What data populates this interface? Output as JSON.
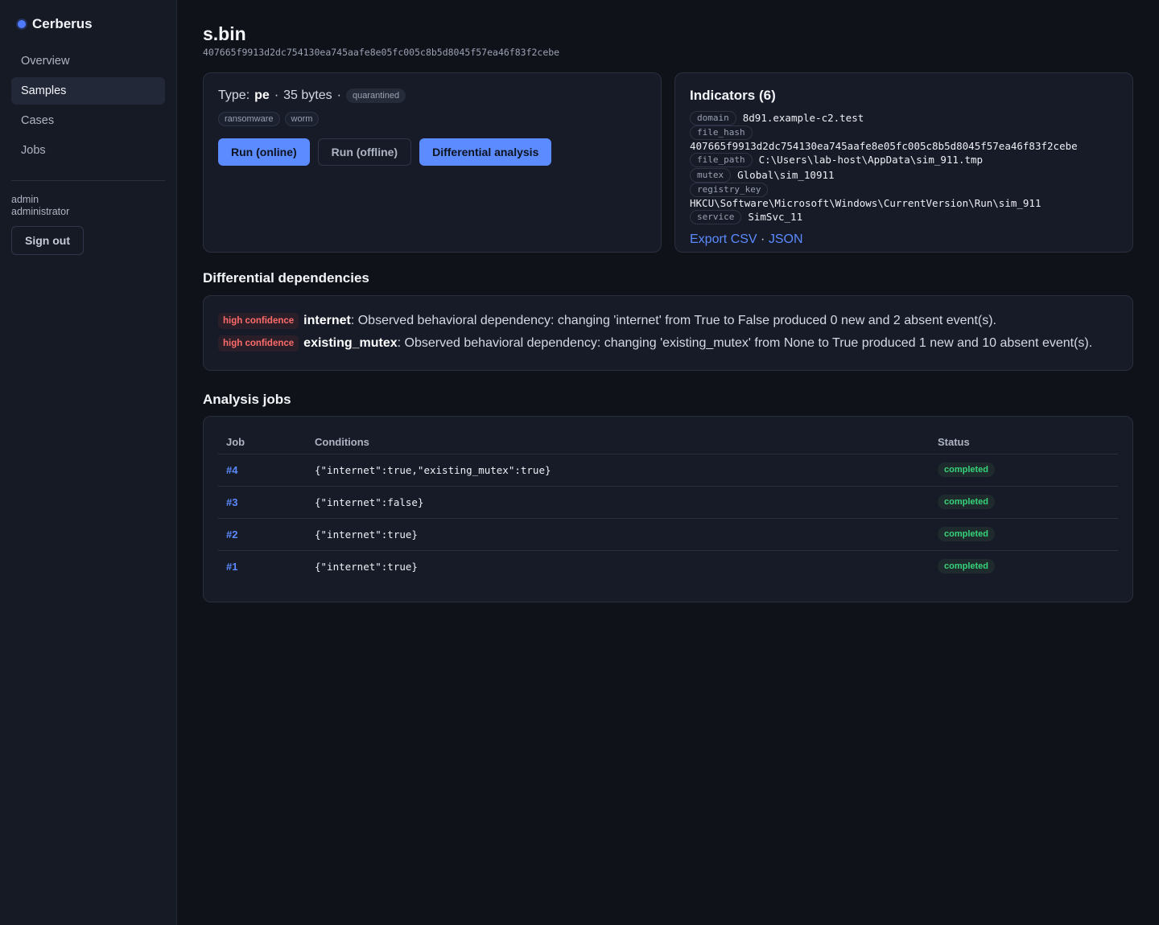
{
  "app": {
    "name": "Cerberus"
  },
  "nav": {
    "items": [
      {
        "label": "Overview"
      },
      {
        "label": "Samples"
      },
      {
        "label": "Cases"
      },
      {
        "label": "Jobs"
      }
    ]
  },
  "user": {
    "name": "admin",
    "role": "administrator",
    "signout_label": "Sign out"
  },
  "sample": {
    "name": "s.bin",
    "hash": "407665f9913d2dc754130ea745aafe8e05fc005c8b5d8045f57ea46f83f2cebe",
    "type_label": "Type:",
    "type": "pe",
    "separator": "·",
    "size": "35 bytes",
    "status": "quarantined",
    "tags": [
      "ransomware",
      "worm"
    ]
  },
  "actions": {
    "run_online": "Run (online)",
    "run_offline": "Run (offline)",
    "differential": "Differential analysis"
  },
  "indicators": {
    "title": "Indicators (6)",
    "items": [
      {
        "key": "domain",
        "value": "8d91.example-c2.test"
      },
      {
        "key": "file_hash",
        "value": "407665f9913d2dc754130ea745aafe8e05fc005c8b5d8045f57ea46f83f2cebe"
      },
      {
        "key": "file_path",
        "value": "C:\\Users\\lab-host\\AppData\\sim_911.tmp"
      },
      {
        "key": "mutex",
        "value": "Global\\sim_10911"
      },
      {
        "key": "registry_key",
        "value": "HKCU\\Software\\Microsoft\\Windows\\CurrentVersion\\Run\\sim_911"
      },
      {
        "key": "service",
        "value": "SimSvc_11"
      }
    ],
    "export_csv": "Export CSV",
    "export_sep": "·",
    "export_json": "JSON"
  },
  "dependencies": {
    "title": "Differential dependencies",
    "items": [
      {
        "confidence": "high confidence",
        "name": "internet",
        "text": ": Observed behavioral dependency: changing 'internet' from True to False produced 0 new and 2 absent event(s)."
      },
      {
        "confidence": "high confidence",
        "name": "existing_mutex",
        "text": ": Observed behavioral dependency: changing 'existing_mutex' from None to True produced 1 new and 10 absent event(s)."
      }
    ]
  },
  "jobs": {
    "title": "Analysis jobs",
    "columns": [
      "Job",
      "Conditions",
      "Status"
    ],
    "rows": [
      {
        "id": "#4",
        "conditions": "{\"internet\":true,\"existing_mutex\":true}",
        "status": "completed"
      },
      {
        "id": "#3",
        "conditions": "{\"internet\":false}",
        "status": "completed"
      },
      {
        "id": "#2",
        "conditions": "{\"internet\":true}",
        "status": "completed"
      },
      {
        "id": "#1",
        "conditions": "{\"internet\":true}",
        "status": "completed"
      }
    ]
  },
  "colors": {
    "accent": "#5b8bff",
    "danger": "#ff6b6b",
    "success": "#36d37a",
    "background": "#10121a",
    "sidebar": "#161a25"
  }
}
